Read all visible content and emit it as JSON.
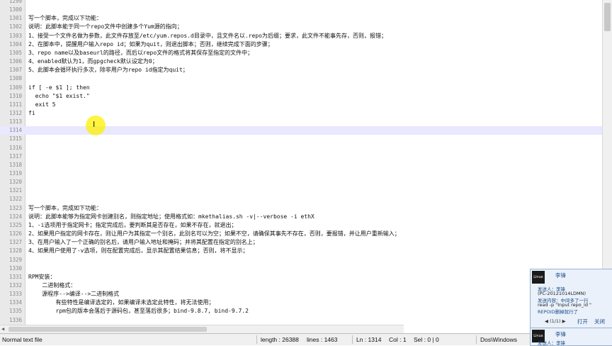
{
  "lines": [
    {
      "n": "1299",
      "t": ""
    },
    {
      "n": "1300",
      "t": ""
    },
    {
      "n": "1301",
      "t": "写一个脚本，完成以下功能："
    },
    {
      "n": "1302",
      "t": "说明：此脚本能于同一个repo文件中创建多个Yum源的指向；"
    },
    {
      "n": "1303",
      "t": "1、接受一个文件名做为参数，此文件存放至/etc/yum.repos.d目录中，且文件名以.repo为后缀；要求，此文件不能事先存，否则，报错；"
    },
    {
      "n": "1304",
      "t": "2、在脚本中，提醒用户输入repo id；如果为quit，则退出脚本；否则，继续完成下面的步骤；"
    },
    {
      "n": "1305",
      "t": "3、repo name以及baseurl的路径，而后以repo文件的格式将其保存至指定的文件中；"
    },
    {
      "n": "1306",
      "t": "4、enabled默认为1，而gpgcheck默认设定为0；"
    },
    {
      "n": "1307",
      "t": "5、此脚本会循环执行多次，除非用户为repo id指定为quit；"
    },
    {
      "n": "1308",
      "t": ""
    },
    {
      "n": "1309",
      "t": "if [ -e $1 ]; then"
    },
    {
      "n": "1310",
      "t": "  echo \"$1 exist.\""
    },
    {
      "n": "1311",
      "t": "  exit 5"
    },
    {
      "n": "1312",
      "t": "fi"
    },
    {
      "n": "1313",
      "t": ""
    },
    {
      "n": "1314",
      "t": ""
    },
    {
      "n": "1315",
      "t": ""
    },
    {
      "n": "1316",
      "t": ""
    },
    {
      "n": "1317",
      "t": ""
    },
    {
      "n": "1318",
      "t": ""
    },
    {
      "n": "1319",
      "t": ""
    },
    {
      "n": "1320",
      "t": ""
    },
    {
      "n": "1321",
      "t": ""
    },
    {
      "n": "1322",
      "t": ""
    },
    {
      "n": "1323",
      "t": "写一个脚本，完成如下功能："
    },
    {
      "n": "1324",
      "t": "说明：此脚本能够为指定网卡创建别名，则指定地址；使用格式如：mkethalias.sh -v|--verbose -i ethX"
    },
    {
      "n": "1325",
      "t": "1、-i选项用于指定网卡；指定完成后，要判断其是否存在，如果不存在，就退出；"
    },
    {
      "n": "1326",
      "t": "2、如果用户指定的网卡存在，则让用户为其指定一个别名，此别名可以为空；如果不空，请确保其事先不存在，否则，要报错，并让用户重新输入；"
    },
    {
      "n": "1327",
      "t": "3、在用户输入了一个正确的别名后，请用户输入地址和掩码；并将其配置在指定的别名上；"
    },
    {
      "n": "1328",
      "t": "4、如果用户使用了-v选项，则在配置完成后，显示其配置结果信息；否则，将不显示；"
    },
    {
      "n": "1329",
      "t": ""
    },
    {
      "n": "1330",
      "t": ""
    },
    {
      "n": "1331",
      "t": "RPM安装："
    },
    {
      "n": "1332",
      "t": "    二进制格式："
    },
    {
      "n": "1333",
      "t": "    源程序-->编译-->二进制格式"
    },
    {
      "n": "1334",
      "t": "        有些特性是编译选定的，如果编译未选定此特性，将无法使用；"
    },
    {
      "n": "1335",
      "t": "        rpm包的版本会落后于源码包，甚至落后很多；bind-9.8.7, bind-9.7.2"
    },
    {
      "n": "1336",
      "t": ""
    }
  ],
  "current_line": "1314",
  "status": {
    "file_type": "Normal text file",
    "length": "length : 26388",
    "lines": "lines : 1463",
    "ln": "Ln : 1314",
    "col": "Col : 1",
    "sel": "Sel : 0 | 0",
    "eol": "Dos\\Windows"
  },
  "qq": {
    "avatar": "Linux",
    "name": "李锋",
    "sender": "发送人：李锋",
    "sender_id": "(PC-20121014LDMN)",
    "content": "发送内容：中间多了一行",
    "code": "read -p \"Input repo_id \"",
    "tail": "REPOID删掉就行了",
    "pager": "◀ (1/1) ▶",
    "open": "打开",
    "close": "关闭"
  },
  "qq2": {
    "avatar": "Linux",
    "name": "李锋",
    "sender": "发送人：李锋"
  },
  "colors": {
    "current_line": "#e8e8ff",
    "cursor_halo": "#fff000"
  }
}
